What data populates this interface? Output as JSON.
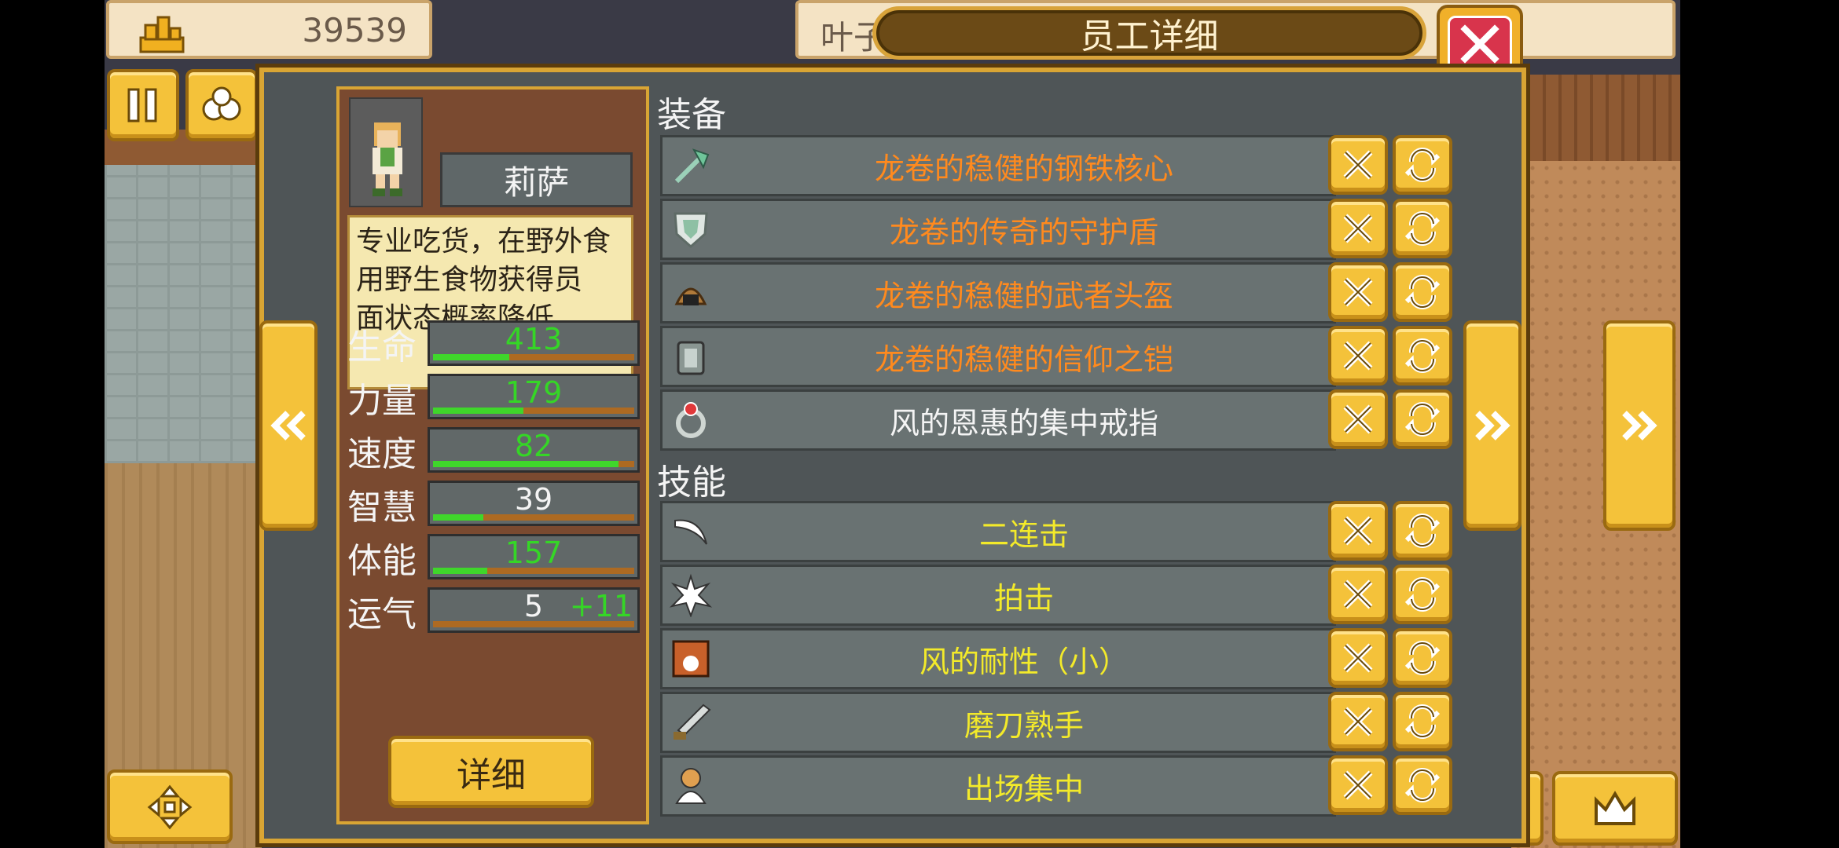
{
  "top_bar": {
    "money": "39539",
    "name_partial": "叶子"
  },
  "title": "员工详细",
  "employee": {
    "name": "莉萨",
    "description": "专业吃货，在野外食用野生食物获得员面状态概率降低",
    "description_lines": [
      "专业吃货，在野外食",
      "用野生食物获得员",
      "面状态概率降低"
    ],
    "stats": [
      {
        "label": "生命",
        "value": "413",
        "fill": 0.38,
        "color": "#35d626",
        "bonus": ""
      },
      {
        "label": "力量",
        "value": "179",
        "fill": 0.45,
        "color": "#35d626",
        "bonus": ""
      },
      {
        "label": "速度",
        "value": "82",
        "fill": 0.92,
        "color": "#35d626",
        "bonus": ""
      },
      {
        "label": "智慧",
        "value": "39",
        "fill": 0.25,
        "color": "#f4f4f4",
        "bonus": ""
      },
      {
        "label": "体能",
        "value": "157",
        "fill": 0.27,
        "color": "#35d626",
        "bonus": ""
      },
      {
        "label": "运气",
        "value": "5",
        "fill": 0.0,
        "color": "#f4f4f4",
        "bonus": "+11"
      }
    ],
    "detail_label": "详细"
  },
  "equipment": {
    "title": "装备",
    "items": [
      {
        "name": "龙卷的稳健的钢铁核心",
        "icon": "axe-icon",
        "color": "orange"
      },
      {
        "name": "龙卷的传奇的守护盾",
        "icon": "shield-icon",
        "color": "orange"
      },
      {
        "name": "龙卷的稳健的武者头盔",
        "icon": "helmet-icon",
        "color": "orange"
      },
      {
        "name": "龙卷的稳健的信仰之铠",
        "icon": "armor-icon",
        "color": "orange"
      },
      {
        "name": "风的恩惠的集中戒指",
        "icon": "ring-icon",
        "color": "white"
      }
    ]
  },
  "skills": {
    "title": "技能",
    "items": [
      {
        "name": "二连击",
        "icon": "slash-icon",
        "color": "yellow"
      },
      {
        "name": "拍击",
        "icon": "impact-icon",
        "color": "yellow"
      },
      {
        "name": "风的耐性（小）",
        "icon": "resist-icon",
        "color": "yellow"
      },
      {
        "name": "磨刀熟手",
        "icon": "sword-icon",
        "color": "yellow"
      },
      {
        "name": "出场集中",
        "icon": "focus-icon",
        "color": "yellow"
      }
    ]
  }
}
